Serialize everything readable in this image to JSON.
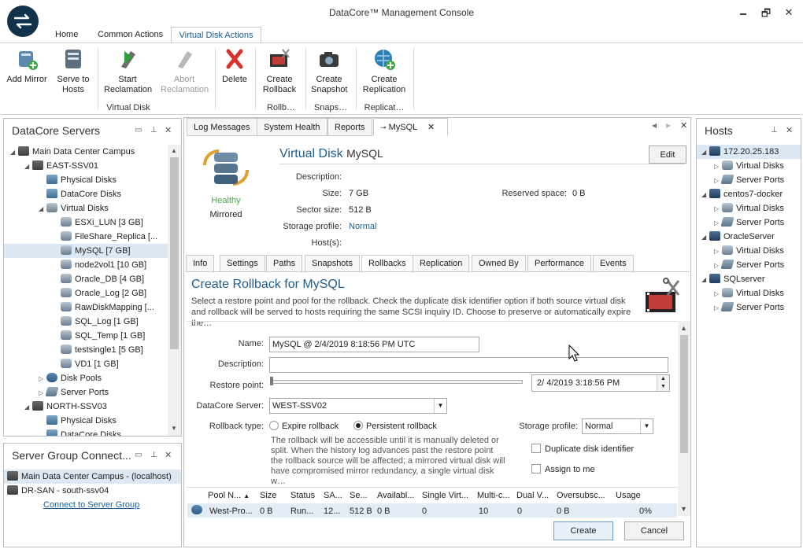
{
  "app": {
    "title": "DataCore™ Management Console"
  },
  "window_controls": {
    "minimize": "🗕",
    "restore": "🗗",
    "close": "✕"
  },
  "ribbon": {
    "tabs": [
      "Home",
      "Common Actions",
      "Virtual Disk Actions"
    ],
    "buttons": {
      "add_mirror": "Add Mirror",
      "serve_to_hosts": "Serve to Hosts",
      "start_reclamation": "Start Reclamation",
      "abort_reclamation": "Abort Reclamation",
      "delete": "Delete",
      "create_rollback": "Create Rollback",
      "create_snapshot": "Create Snapshot",
      "create_replication": "Create Replication"
    },
    "groups": {
      "virtual_disk": "Virtual Disk",
      "rollback": "Rollb…",
      "snapshot": "Snaps…",
      "replication": "Replicat…"
    }
  },
  "servers_panel": {
    "title": "DataCore Servers",
    "tree": [
      {
        "label": "Main Data Center Campus",
        "level": 0,
        "icon": "server-group-icon",
        "arrow": "◢"
      },
      {
        "label": "EAST-SSV01",
        "level": 1,
        "icon": "server-icon",
        "arrow": "◢"
      },
      {
        "label": "Physical Disks",
        "level": 2,
        "icon": "physical-disks-icon",
        "arrow": ""
      },
      {
        "label": "DataCore Disks",
        "level": 2,
        "icon": "datacore-disks-icon",
        "arrow": ""
      },
      {
        "label": "Virtual Disks",
        "level": 2,
        "icon": "virtual-disks-icon",
        "arrow": "◢"
      },
      {
        "label": "ESXi_LUN   [3 GB]",
        "level": 3,
        "icon": "virtual-disk-icon",
        "arrow": ""
      },
      {
        "label": "FileShare_Replica   [...",
        "level": 3,
        "icon": "virtual-disk-icon",
        "arrow": ""
      },
      {
        "label": "MySQL   [7 GB]",
        "level": 3,
        "icon": "virtual-disk-icon",
        "arrow": "",
        "selected": true
      },
      {
        "label": "node2vol1   [10 GB]",
        "level": 3,
        "icon": "virtual-disk-icon",
        "arrow": ""
      },
      {
        "label": "Oracle_DB   [4 GB]",
        "level": 3,
        "icon": "virtual-disk-icon",
        "arrow": ""
      },
      {
        "label": "Oracle_Log   [2 GB]",
        "level": 3,
        "icon": "virtual-disk-icon",
        "arrow": ""
      },
      {
        "label": "RawDiskMapping   [...",
        "level": 3,
        "icon": "virtual-disk-icon",
        "arrow": ""
      },
      {
        "label": "SQL_Log   [1 GB]",
        "level": 3,
        "icon": "virtual-disk-icon",
        "arrow": ""
      },
      {
        "label": "SQL_Temp   [1 GB]",
        "level": 3,
        "icon": "virtual-disk-icon",
        "arrow": ""
      },
      {
        "label": "testsingle1   [5 GB]",
        "level": 3,
        "icon": "virtual-disk-icon",
        "arrow": ""
      },
      {
        "label": "VD1   [1 GB]",
        "level": 3,
        "icon": "virtual-disk-icon",
        "arrow": ""
      },
      {
        "label": "Disk Pools",
        "level": 2,
        "icon": "disk-pools-icon",
        "arrow": "▷"
      },
      {
        "label": "Server Ports",
        "level": 2,
        "icon": "server-ports-icon",
        "arrow": "▷"
      },
      {
        "label": "NORTH-SSV03",
        "level": 1,
        "icon": "server-icon",
        "arrow": "◢"
      },
      {
        "label": "Physical Disks",
        "level": 2,
        "icon": "physical-disks-icon",
        "arrow": ""
      },
      {
        "label": "DataCore Disks",
        "level": 2,
        "icon": "datacore-disks-icon",
        "arrow": ""
      }
    ]
  },
  "group_panel": {
    "title": "Server Group Connect...",
    "items": [
      "Main Data Center Campus - (localhost)",
      "DR-SAN - south-ssv04"
    ],
    "link": "Connect to Server Group"
  },
  "doc_tabs": [
    "Log Messages",
    "System Health",
    "Reports",
    "MySQL"
  ],
  "vdisk": {
    "heading_prefix": "Virtual Disk",
    "name": "MySQL",
    "edit_label": "Edit",
    "status_health": "Healthy",
    "status_mode": "Mirrored",
    "labels": {
      "description": "Description:",
      "size": "Size:",
      "sector_size": "Sector size:",
      "storage_profile": "Storage profile:",
      "hosts": "Host(s):",
      "reserved": "Reserved space:"
    },
    "values": {
      "size": "7 GB",
      "sector_size": "512 B",
      "storage_profile": "Normal",
      "reserved": "0 B"
    }
  },
  "inner_tabs": [
    "Info",
    "Settings",
    "Paths",
    "Snapshots",
    "Rollbacks",
    "Replication",
    "Owned By",
    "Performance",
    "Events"
  ],
  "rollback_form": {
    "title": "Create Rollback for MySQL",
    "description": "Select a restore point and pool for the rollback. Check the duplicate disk identifier option if both source virtual disk and rollback will be served to hosts requiring the same SCSI inquiry ID. Choose to preserve or automatically expire the…",
    "name_label": "Name:",
    "name_value": "MySQL @ 2/4/2019 8:18:56 PM UTC",
    "description_label": "Description:",
    "description_value": "",
    "restore_label": "Restore point:",
    "restore_date": "2/  4/2019   3:18:56 PM",
    "server_label": "DataCore Server:",
    "server_value": "WEST-SSV02",
    "type_label": "Rollback type:",
    "expire_option": "Expire rollback",
    "persistent_option": "Persistent rollback",
    "type_note": "The rollback will be accessible until it is manually deleted or split. When the history log advances past the restore point the rollback source will be affected; a mirrored virtual disk will have compromised mirror redundancy, a single virtual disk w…",
    "profile_label": "Storage profile:",
    "profile_value": "Normal",
    "duplicate_label": "Duplicate disk identifier",
    "assign_label": "Assign to me",
    "grid_headers": [
      "Pool N...",
      "Size",
      "Status",
      "SA...",
      "Se...",
      "Availabl...",
      "Single Virt...",
      "Multi-c...",
      "Dual V...",
      "Oversubsc...",
      "Usage"
    ],
    "grid_row": [
      "West-Pro...",
      "0 B",
      "Run...",
      "12...",
      "512 B",
      "0 B",
      "0",
      "10",
      "0",
      "0 B",
      "0%"
    ],
    "create_label": "Create",
    "cancel_label": "Cancel"
  },
  "hosts_panel": {
    "title": "Hosts",
    "tree": [
      {
        "label": "172.20.25.183",
        "level": 0,
        "icon": "host-icon",
        "arrow": "◢",
        "selected": true
      },
      {
        "label": "Virtual Disks",
        "level": 1,
        "icon": "virtual-disks-icon",
        "arrow": "▷"
      },
      {
        "label": "Server Ports",
        "level": 1,
        "icon": "server-ports-icon",
        "arrow": "▷"
      },
      {
        "label": "centos7-docker",
        "level": 0,
        "icon": "host-icon",
        "arrow": "◢"
      },
      {
        "label": "Virtual Disks",
        "level": 1,
        "icon": "virtual-disks-icon",
        "arrow": "▷"
      },
      {
        "label": "Server Ports",
        "level": 1,
        "icon": "server-ports-icon",
        "arrow": "▷"
      },
      {
        "label": "OracleServer",
        "level": 0,
        "icon": "host-icon",
        "arrow": "◢"
      },
      {
        "label": "Virtual Disks",
        "level": 1,
        "icon": "virtual-disks-icon",
        "arrow": "▷"
      },
      {
        "label": "Server Ports",
        "level": 1,
        "icon": "server-ports-icon",
        "arrow": "▷"
      },
      {
        "label": "SQLserver",
        "level": 0,
        "icon": "host-icon",
        "arrow": "◢"
      },
      {
        "label": "Virtual Disks",
        "level": 1,
        "icon": "virtual-disks-icon",
        "arrow": "▷"
      },
      {
        "label": "Server Ports",
        "level": 1,
        "icon": "server-ports-icon",
        "arrow": "▷"
      }
    ]
  }
}
